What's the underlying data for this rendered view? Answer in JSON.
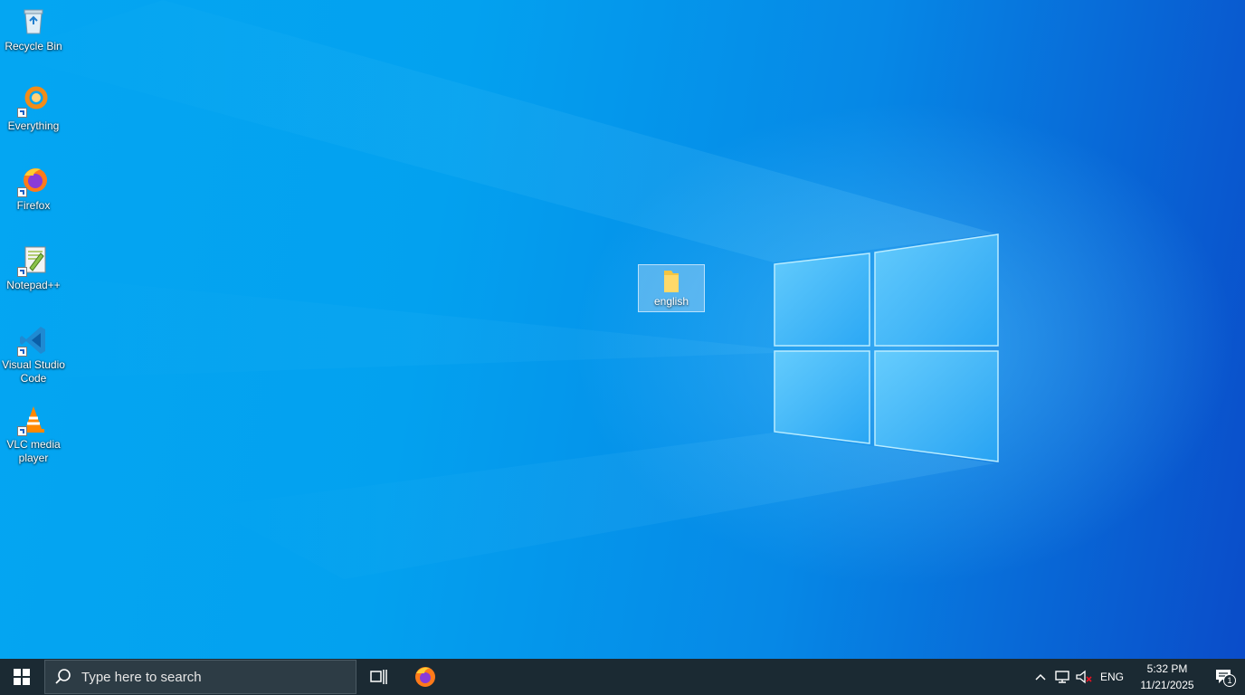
{
  "desktop": {
    "icons": [
      {
        "label": "Recycle Bin",
        "icon": "recycle-bin-icon"
      },
      {
        "label": "Everything",
        "icon": "everything-icon"
      },
      {
        "label": "Firefox",
        "icon": "firefox-icon"
      },
      {
        "label": "Notepad++",
        "icon": "notepad-plus-plus-icon"
      },
      {
        "label": "Visual Studio Code",
        "icon": "vscode-icon"
      },
      {
        "label": "VLC media player",
        "icon": "vlc-icon"
      }
    ],
    "folder": {
      "label": "english",
      "icon": "folder-icon",
      "selected": true
    }
  },
  "taskbar": {
    "start_icon": "windows-logo-icon",
    "search_placeholder": "Type here to search",
    "task_view_icon": "task-view-icon",
    "pinned": [
      {
        "name": "Firefox",
        "icon": "firefox-icon"
      }
    ],
    "tray": {
      "language": "ENG",
      "time": "5:32 PM",
      "date": "11/21/2025",
      "notifications_count": "1",
      "icons": [
        "chevron-up-icon",
        "network-icon",
        "volume-muted-icon",
        "notification-icon"
      ]
    }
  },
  "colors": {
    "wallpaper_light": "#04a6f2",
    "wallpaper_dark": "#0a4cc9",
    "taskbar": "#1b2a33",
    "search_box": "#2d3c45"
  }
}
